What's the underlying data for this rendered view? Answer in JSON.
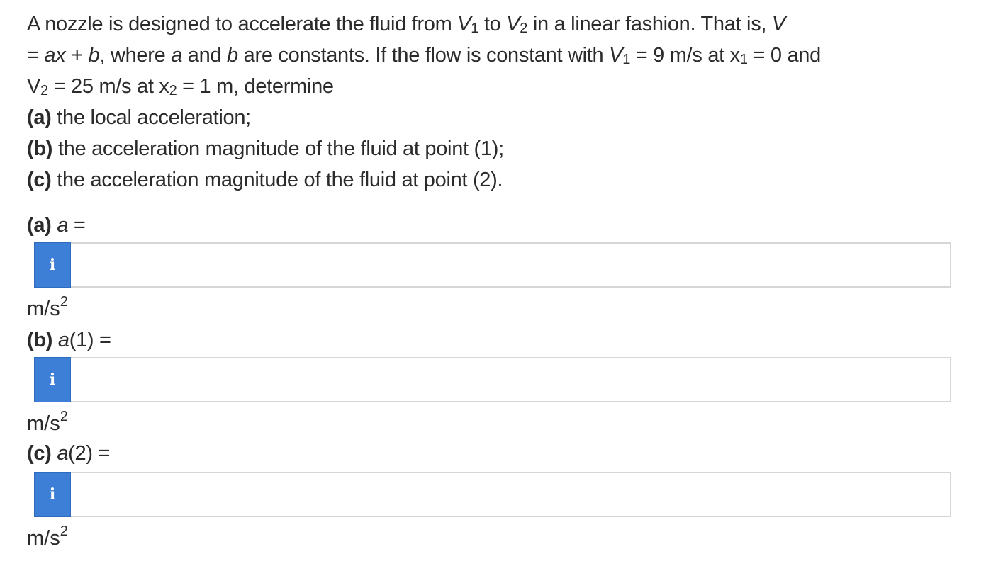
{
  "problem": {
    "line1_a": "A nozzle is designed to accelerate the fluid from ",
    "V": "V",
    "sub1": "1",
    "to": " to ",
    "sub2": "2",
    "line1_b": " in a linear fashion. That is, ",
    "line1_c": "V",
    "line2_a": "= ",
    "line2_ax": "ax",
    "line2_plus": " + ",
    "line2_b": "b",
    "line2_c": ", where ",
    "line2_a_var": "a",
    "line2_and": " and ",
    "line2_b_var": "b",
    "line2_d": " are constants. If the flow is constant with ",
    "line2_e": " = 9 m/s at x",
    "line2_f": " = 0 and",
    "line3_a": " = 25 m/s at x",
    "line3_b": " = 1 m, determine",
    "part_a_label": "(a)",
    "part_a_text": " the local acceleration;",
    "part_b_label": "(b)",
    "part_b_text": " the acceleration magnitude of the fluid at point (1);",
    "part_c_label": "(c)",
    "part_c_text": " the acceleration magnitude of the fluid at point (2)."
  },
  "questions": [
    {
      "label_bold": "(a)",
      "label_var": "a",
      "label_rest": " =",
      "info_icon": "i",
      "value": "",
      "unit_base": "m/s",
      "unit_exp": "2"
    },
    {
      "label_bold": "(b)",
      "label_var": "a",
      "label_rest": "(1) =",
      "info_icon": "i",
      "value": "",
      "unit_base": "m/s",
      "unit_exp": "2"
    },
    {
      "label_bold": "(c)",
      "label_var": "a",
      "label_rest": "(2) =",
      "info_icon": "i",
      "value": "",
      "unit_base": "m/s",
      "unit_exp": "2"
    }
  ],
  "colors": {
    "info_button": "#3d7ed6",
    "input_border": "#d6d6d6",
    "text": "#2b2b2b"
  }
}
